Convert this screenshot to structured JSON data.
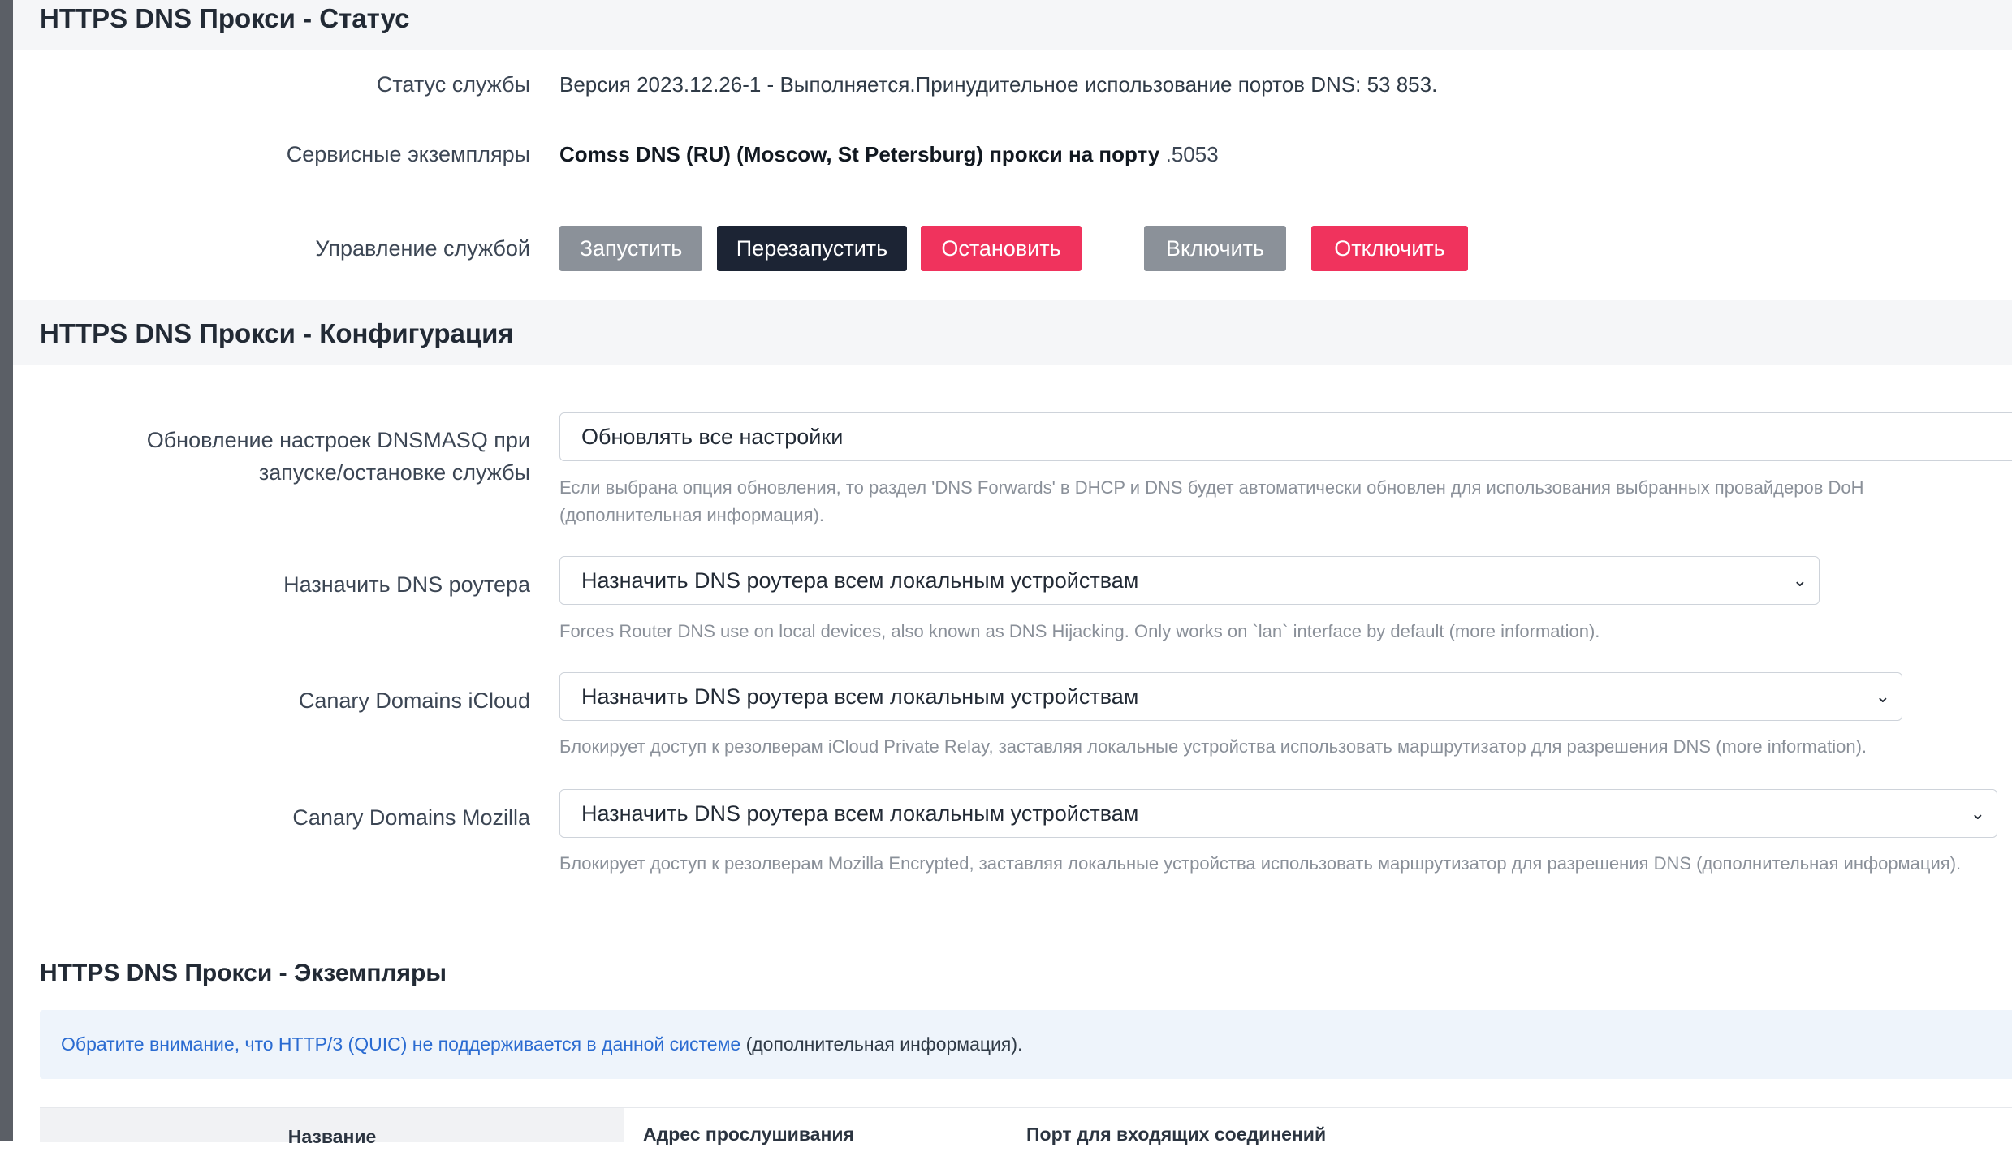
{
  "status_section": {
    "title": "HTTPS DNS Прокси - Статус",
    "service_status_label": "Статус службы",
    "service_status_value": "Версия 2023.12.26-1 - Выполняется.Принудительное использование портов DNS: 53 853.",
    "instances_label": "Сервисные экземпляры",
    "instances_value_bold": "Comss DNS (RU) (Moscow, St Petersburg) прокси на порту",
    "instances_port": ".5053",
    "control_label": "Управление службой",
    "buttons": {
      "start": "Запустить",
      "restart": "Перезапустить",
      "stop": "Остановить",
      "enable": "Включить",
      "disable": "Отключить"
    }
  },
  "config_section": {
    "title": "HTTPS DNS Прокси - Конфигурация",
    "dnsmasq": {
      "label_line1": "Обновление настроек DNSMASQ при",
      "label_line2": "запуске/остановке службы",
      "value": "Обновлять все настройки",
      "help_line1": "Если выбрана опция обновления, то раздел 'DNS Forwards' в DHCP и DNS будет автоматически обновлен для использования выбранных провайдеров DoH",
      "help_line2": "(дополнительная информация)."
    },
    "router_dns": {
      "label": "Назначить DNS роутера",
      "value": "Назначить DNS роутера всем локальным устройствам",
      "help": "Forces Router DNS use on local devices, also known as DNS Hijacking. Only works on `lan` interface by default (more information)."
    },
    "icloud": {
      "label": "Canary Domains iCloud",
      "value": "Назначить DNS роутера всем локальным устройствам",
      "help": "Блокирует доступ к резолверам iCloud Private Relay, заставляя локальные устройства использовать маршрутизатор для разрешения DNS (more information)."
    },
    "mozilla": {
      "label": "Canary Domains Mozilla",
      "value": "Назначить DNS роутера всем локальным устройствам",
      "help": "Блокирует доступ к резолверам Mozilla Encrypted, заставляя локальные устройства использовать маршрутизатор для разрешения DNS (дополнительная информация)."
    }
  },
  "instances_section": {
    "title": "HTTPS DNS Прокси - Экземпляры",
    "notice_link": "Обратите внимание, что HTTP/3 (QUIC) не поддерживается в данной системе",
    "notice_rest": " (дополнительная информация).",
    "table_headers": {
      "name": "Название",
      "listen_address": "Адрес прослушивания",
      "port": "Порт для входящих соединений"
    }
  },
  "colors": {
    "grey_button": "#8b9199",
    "dark_button": "#1c2434",
    "red_button": "#f0335d",
    "section_bg": "#f5f6f8",
    "notice_bg": "#eef4fb",
    "link": "#2a6bd1"
  },
  "icons": {
    "select_chevron": "chevron-down-icon"
  }
}
